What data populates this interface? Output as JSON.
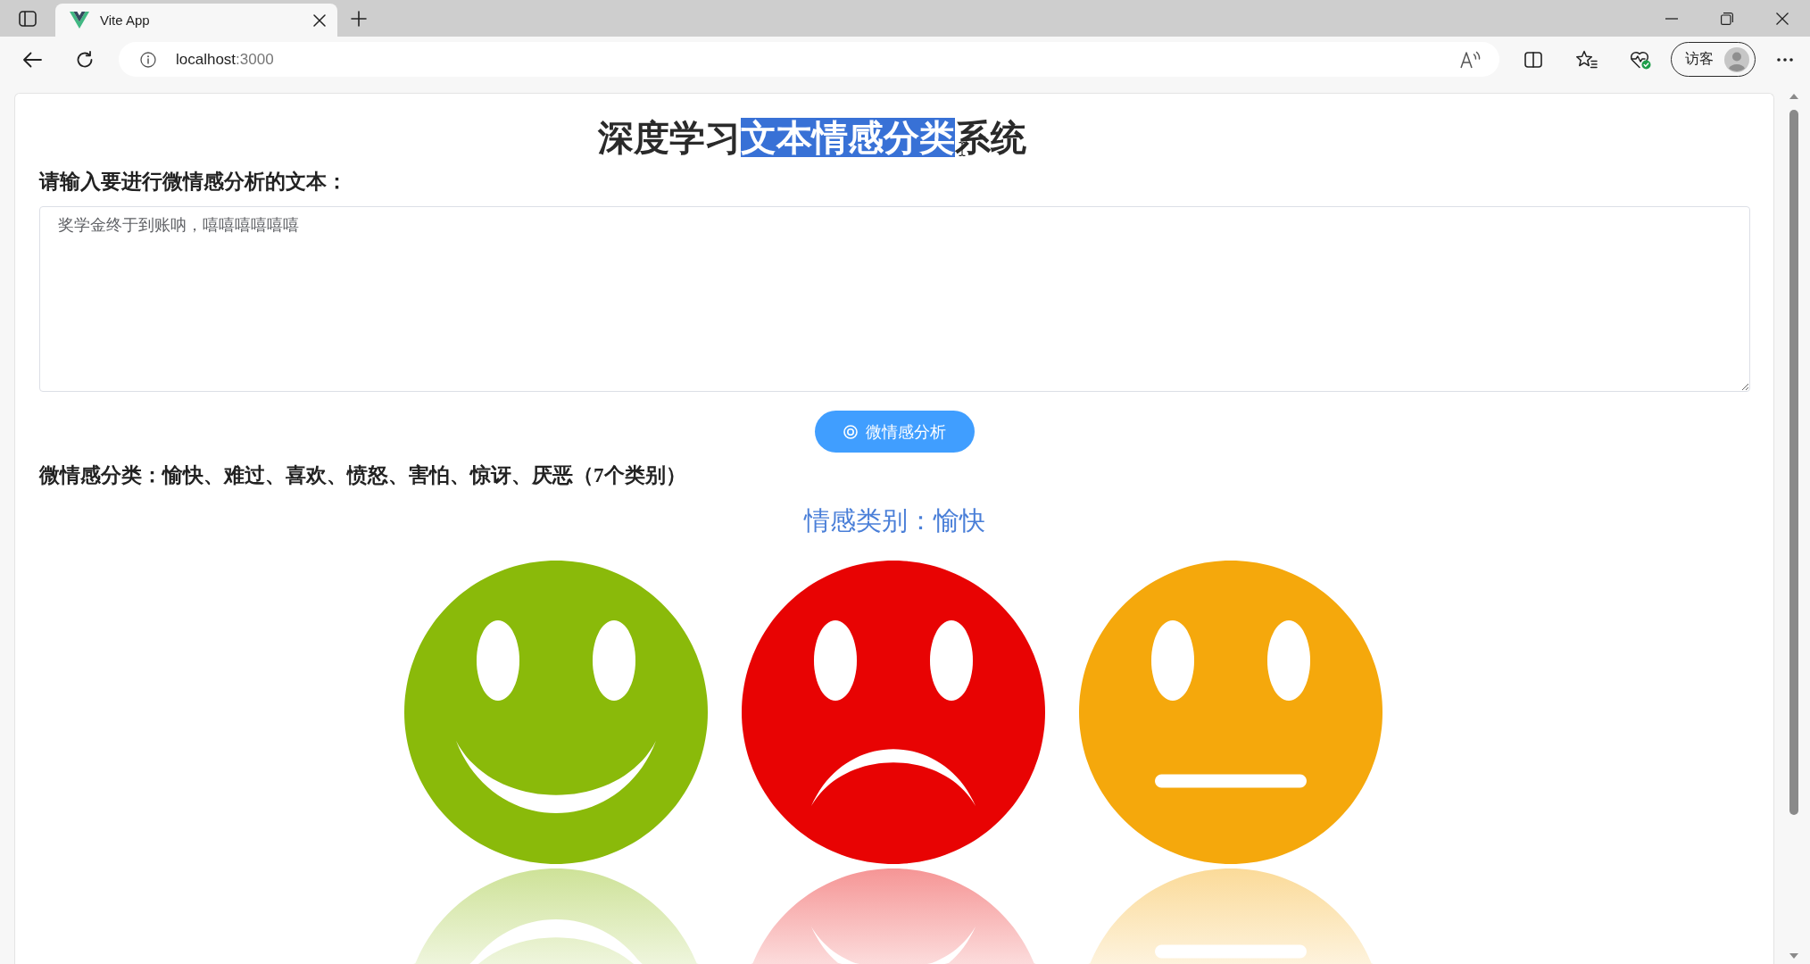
{
  "browser": {
    "tabs": [
      {
        "title": "Vite App",
        "selected": true
      }
    ],
    "address": {
      "host": "localhost",
      "port": ":3000"
    },
    "profile_button": {
      "label": "访客"
    }
  },
  "page": {
    "title": [
      {
        "text": "深度学习",
        "highlighted": false
      },
      {
        "text": "文本情感分类",
        "highlighted": true
      },
      {
        "text": "系统",
        "highlighted": false
      }
    ],
    "input_label": "请输入要进行微情感分析的文本：",
    "text_input": {
      "value": "奖学金终于到账呐，嘻嘻嘻嘻嘻嘻"
    },
    "analyze_button": {
      "label": "微情感分析"
    },
    "categories_text": "微情感分类：愉快、难过、喜欢、愤怒、害怕、惊讶、厌恶（7个类别）",
    "result_text": "情感类别：愉快",
    "illustration": {
      "faces": [
        {
          "kind": "smiling"
        },
        {
          "kind": "frowning"
        },
        {
          "kind": "neutral"
        }
      ]
    }
  }
}
